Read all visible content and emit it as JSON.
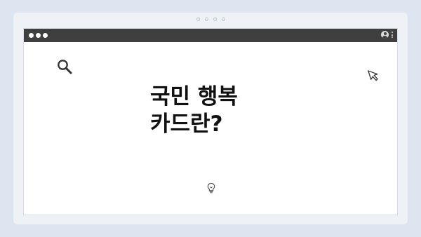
{
  "headline": {
    "line1": "국민 행복",
    "line2": "카드란?"
  },
  "icons": {
    "search": "search-icon",
    "cursor": "cursor-arrow-icon",
    "lightbulb": "lightbulb-icon",
    "user": "user-icon",
    "menu": "kebab-menu-icon"
  },
  "colors": {
    "background": "#dde6f0",
    "frame": "#eef1f6",
    "titlebar": "#3f3f3f",
    "window": "#ffffff",
    "text": "#111111"
  }
}
